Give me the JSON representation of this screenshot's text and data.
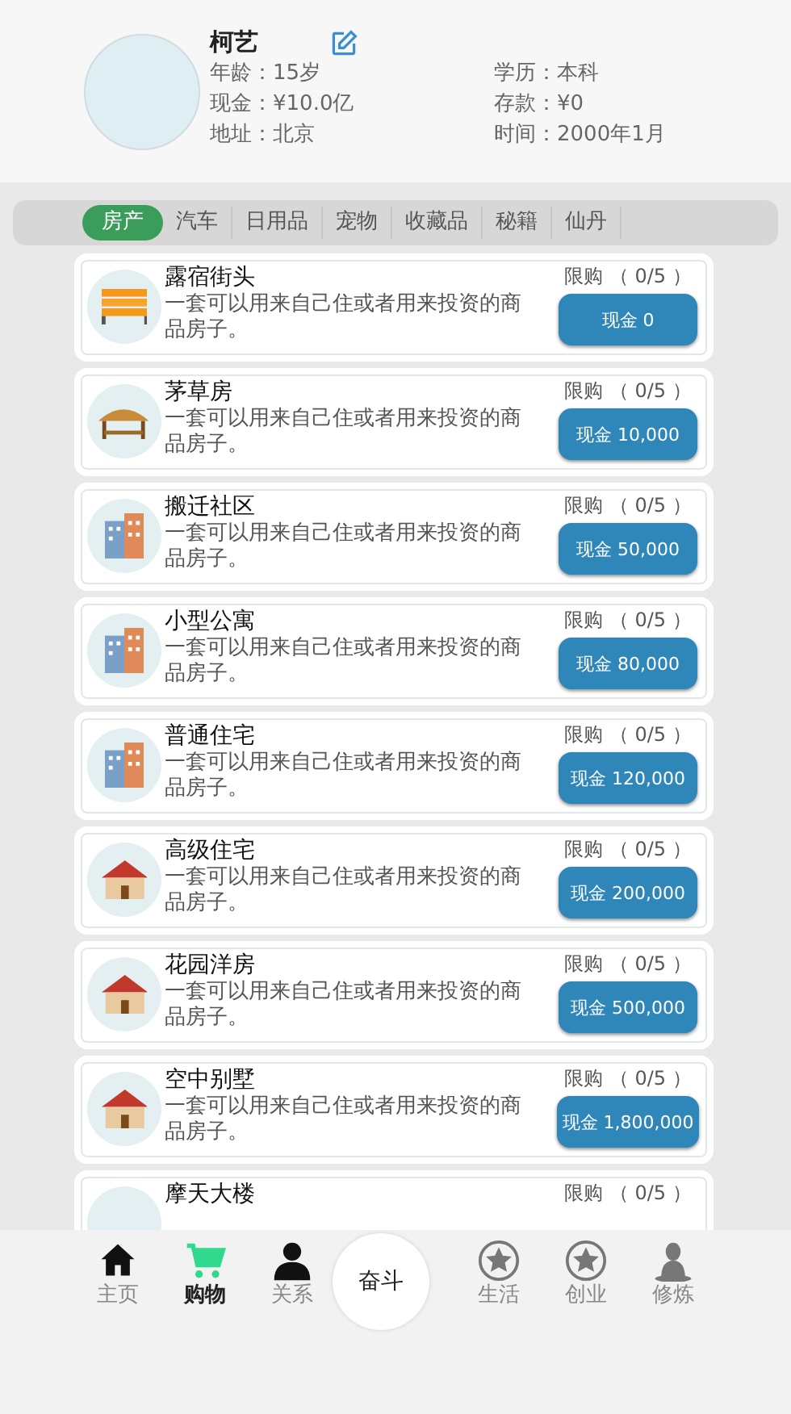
{
  "profile": {
    "name": "柯艺",
    "fields": [
      "年龄：15岁",
      "学历：本科",
      "现金：¥10.0亿",
      "存款：¥0",
      "地址：北京",
      "时间：2000年1月"
    ]
  },
  "tabs": [
    {
      "label": "房产",
      "selected": true
    },
    {
      "label": "汽车",
      "selected": false
    },
    {
      "label": "日用品",
      "selected": false
    },
    {
      "label": "宠物",
      "selected": false
    },
    {
      "label": "收藏品",
      "selected": false
    },
    {
      "label": "秘籍",
      "selected": false
    },
    {
      "label": "仙丹",
      "selected": false
    }
  ],
  "items": [
    {
      "kind": "bench",
      "name": "露宿街头",
      "desc": "一套可以用来自己住或者用来投资的商品房子。",
      "limit": "限购 （ 0/5 ）",
      "price": "现金 0"
    },
    {
      "kind": "hut",
      "name": "茅草房",
      "desc": "一套可以用来自己住或者用来投资的商品房子。",
      "limit": "限购 （ 0/5 ）",
      "price": "现金 10,000"
    },
    {
      "kind": "building",
      "name": "搬迁社区",
      "desc": "一套可以用来自己住或者用来投资的商品房子。",
      "limit": "限购 （ 0/5 ）",
      "price": "现金 50,000"
    },
    {
      "kind": "building",
      "name": "小型公寓",
      "desc": "一套可以用来自己住或者用来投资的商品房子。",
      "limit": "限购 （ 0/5 ）",
      "price": "现金 80,000"
    },
    {
      "kind": "building",
      "name": "普通住宅",
      "desc": "一套可以用来自己住或者用来投资的商品房子。",
      "limit": "限购 （ 0/5 ）",
      "price": "现金 120,000"
    },
    {
      "kind": "house",
      "name": "高级住宅",
      "desc": "一套可以用来自己住或者用来投资的商品房子。",
      "limit": "限购 （ 0/5 ）",
      "price": "现金 200,000"
    },
    {
      "kind": "house",
      "name": "花园洋房",
      "desc": "一套可以用来自己住或者用来投资的商品房子。",
      "limit": "限购 （ 0/5 ）",
      "price": "现金 500,000"
    },
    {
      "kind": "house",
      "name": "空中别墅",
      "desc": "一套可以用来自己住或者用来投资的商品房子。",
      "limit": "限购 （ 0/5 ）",
      "price": "现金 1,800,000"
    },
    {
      "name": "摩天大楼",
      "limit": "限购 （ 0/5 ）"
    }
  ],
  "nav": [
    {
      "kind": "home",
      "label": "主页",
      "selected": false
    },
    {
      "kind": "cart",
      "label": "购物",
      "selected": true
    },
    {
      "kind": "person",
      "label": "关系",
      "selected": false
    },
    {
      "kind": "center",
      "label": "奋斗",
      "selected": false
    },
    {
      "kind": "star",
      "label": "生活",
      "selected": false
    },
    {
      "kind": "star",
      "label": "创业",
      "selected": false
    },
    {
      "kind": "monk",
      "label": "修炼",
      "selected": false
    }
  ]
}
